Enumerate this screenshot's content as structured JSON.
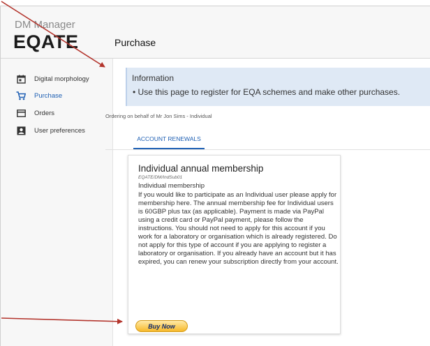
{
  "header": {
    "app_name": "DM Manager",
    "logo_text": "EQATE",
    "page_title": "Purchase"
  },
  "sidebar": {
    "items": [
      {
        "label": "Digital morphology",
        "icon": "calendar-icon",
        "active": false
      },
      {
        "label": "Purchase",
        "icon": "shopping-cart-icon",
        "active": true
      },
      {
        "label": "Orders",
        "icon": "orders-icon",
        "active": false
      },
      {
        "label": "User preferences",
        "icon": "user-icon",
        "active": false
      }
    ]
  },
  "info": {
    "title": "Information",
    "text": "• Use this page to register for EQA schemes and make other purchases."
  },
  "ordering_on_behalf": "Ordering on behalf of Mr Jon Sims - Individual",
  "tabs": [
    {
      "label": "ACCOUNT RENEWALS",
      "active": true
    }
  ],
  "card": {
    "title": "Individual annual membership",
    "code": "EQATE/DM/IndSub01",
    "subtitle": "Individual membership",
    "description": "If you would like to participate as an Individual user please apply for membership here. The annual membership fee for Individual users is 60GBP plus tax (as applicable). Payment is made via PayPal using a credit card or PayPal payment, please follow the instructions. You should not need to apply for this account if you work for a laboratory or organisation which is already registered. Do not apply for this type of account if you are applying to register a laboratory or organisation. If you already have an account but it has expired, you can renew your subscription directly from your account.",
    "buy_label": "Buy Now"
  },
  "colors": {
    "accent_blue": "#1e5fb3",
    "info_bg": "#dfe9f5",
    "arrow_red": "#b3342c",
    "button_gold": "#f7b92a"
  }
}
